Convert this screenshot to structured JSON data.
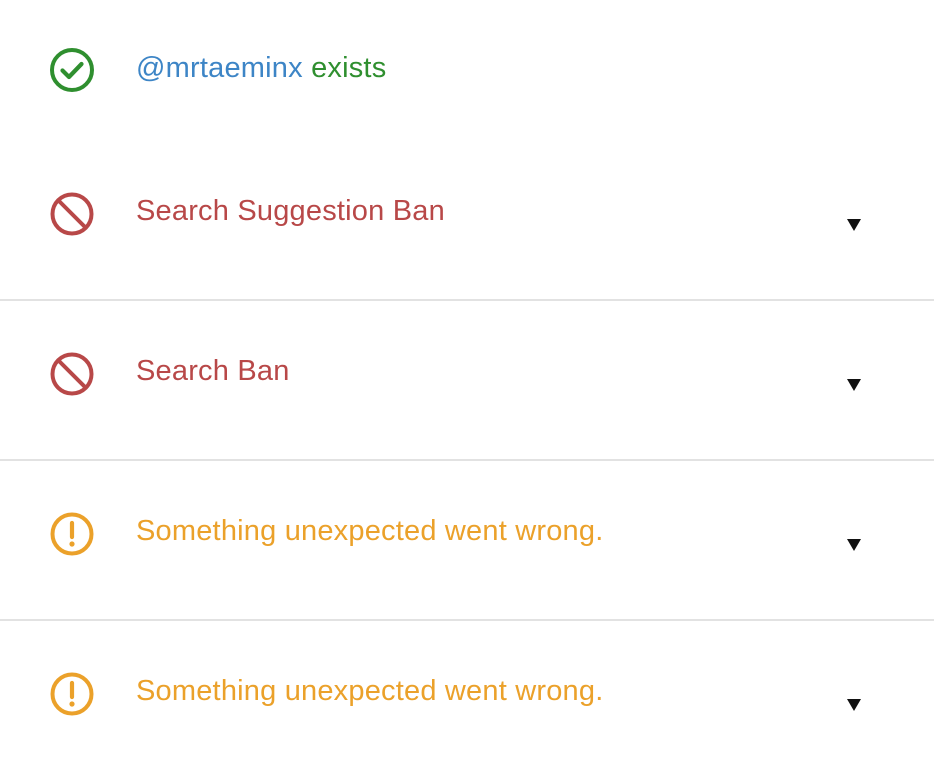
{
  "account": {
    "handle": "@mrtaeminx",
    "status_word": "exists",
    "icon": "check-circle-icon",
    "color": "#2f8f2f",
    "handle_color": "#3d85c6"
  },
  "checks": [
    {
      "label": "Search Suggestion Ban",
      "status": "banned",
      "icon": "ban-icon",
      "color": "#b84848",
      "expand_icon": "caret-down-icon"
    },
    {
      "label": "Search Ban",
      "status": "banned",
      "icon": "ban-icon",
      "color": "#b84848",
      "expand_icon": "caret-down-icon"
    },
    {
      "label": "Something unexpected went wrong.",
      "status": "error",
      "icon": "exclamation-circle-icon",
      "color": "#eba12a",
      "expand_icon": "caret-down-icon"
    },
    {
      "label": "Something unexpected went wrong.",
      "status": "error",
      "icon": "exclamation-circle-icon",
      "color": "#eba12a",
      "expand_icon": "caret-down-icon"
    }
  ]
}
